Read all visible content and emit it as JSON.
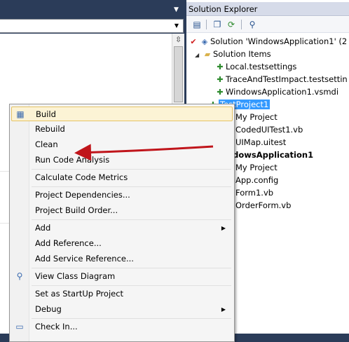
{
  "solution_explorer": {
    "title": "Solution Explorer",
    "toolbar": [
      "properties-icon",
      "show-all-files-icon",
      "refresh-icon",
      "class-diagram-icon"
    ],
    "tree": {
      "solution": "Solution 'WindowsApplication1' (2 pro",
      "solution_items": "Solution Items",
      "file1": "Local.testsettings",
      "file2": "TraceAndTestImpact.testsettin",
      "file3": "WindowsApplication1.vsmdi",
      "test_project": "TestProject1",
      "tp_my_project": "My Project",
      "tp_coded_ui": "CodedUITest1.vb",
      "tp_uimap": "UIMap.uitest",
      "win_app": "indowsApplication1",
      "wa_my_project": "My Project",
      "wa_app_config": "App.config",
      "wa_form1": "Form1.vb",
      "wa_orderform": "OrderForm.vb"
    }
  },
  "context_menu": {
    "items": {
      "build": "Build",
      "rebuild": "Rebuild",
      "clean": "Clean",
      "run_code_analysis": "Run Code Analysis",
      "calc_metrics": "Calculate Code Metrics",
      "project_dependencies": "Project Dependencies...",
      "project_build_order": "Project Build Order...",
      "add": "Add",
      "add_reference": "Add Reference...",
      "add_service_reference": "Add Service Reference...",
      "view_class_diagram": "View Class Diagram",
      "set_startup": "Set as StartUp Project",
      "debug": "Debug",
      "check_in": "Check In..."
    },
    "highlighted": "Build"
  },
  "colors": {
    "ide_background": "#2b3c59",
    "menu_highlight": "#fcf3d5",
    "selection": "#3399ff",
    "annotation_arrow": "#c0151b"
  }
}
